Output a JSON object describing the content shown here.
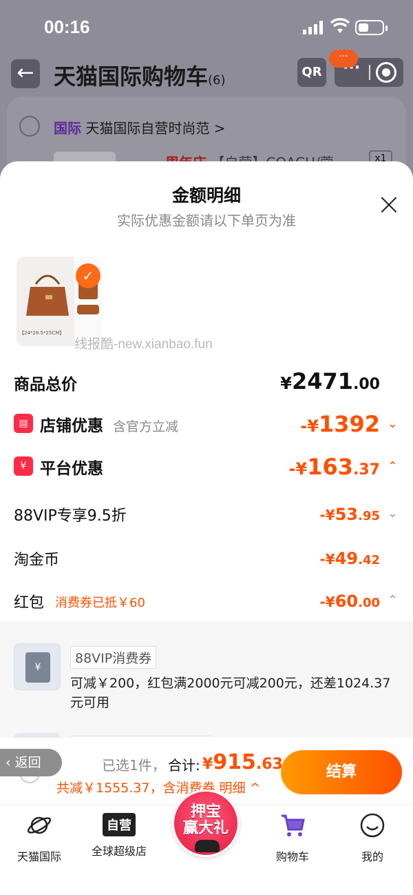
{
  "status_bar": {
    "time": "00:16"
  },
  "header": {
    "title": "天猫国际购物车",
    "count": "(6)",
    "qr_label": "QR",
    "bubble": "···"
  },
  "background_cart": {
    "store_tag": "国际",
    "store_name": "天猫国际自营时尚范 >",
    "product_tag": "周年庆",
    "product_title": "【自营】COACH/蔻",
    "quantity": "x1"
  },
  "sheet": {
    "title": "金额明细",
    "subtitle": "实际优惠金额请以下单页为准",
    "watermark": "线报酷-new.xianbao.fun",
    "thumb_caption": "【24*28.5*25CM】"
  },
  "rows": {
    "total": {
      "label": "商品总价",
      "cur": "¥",
      "int": "2471",
      "dec": ".00"
    },
    "store_discount": {
      "label": "店铺优惠",
      "note": "含官方立减",
      "cur": "-¥",
      "int": "1392",
      "dec": ""
    },
    "platform_discount": {
      "label": "平台优惠",
      "cur": "-¥",
      "int": "163",
      "dec": ".37"
    },
    "vip": {
      "label": "88VIP专享9.5折",
      "cur": "-¥",
      "int": "53",
      "dec": ".95"
    },
    "coins": {
      "label": "淘金币",
      "cur": "-¥",
      "int": "49",
      "dec": ".42"
    },
    "red_packet": {
      "label": "红包",
      "note": "消费券已抵￥60",
      "cur": "-¥",
      "int": "60",
      "dec": ".00"
    }
  },
  "coupon": {
    "tag": "88VIP消费券",
    "description": "可减￥200，红包满2000元可减200元，还差1024.37元可用",
    "icon_symbol": "¥"
  },
  "checkout": {
    "return_label": "返回",
    "selected": "已选1件，",
    "total_label": "合计:",
    "total_cur": "¥",
    "total_int": "915",
    "total_dec": ".63",
    "discount_summary": "共减￥1555.37，含消费券",
    "detail_link": "明细 ^",
    "pay_button": "结算"
  },
  "tabbar": {
    "tabs": [
      {
        "label": "天猫国际",
        "icon": "planet-icon"
      },
      {
        "label": "全球超级店",
        "icon": "ziying-badge",
        "badge": "自营"
      },
      {
        "label": "购物车",
        "icon": "cart-icon"
      },
      {
        "label": "我的",
        "icon": "smile-icon"
      }
    ],
    "promo": {
      "text_line1": "押宝",
      "text_line2": "赢大礼"
    }
  },
  "colors": {
    "accent": "#ff5000",
    "pay_gradient_start": "#ff9a00",
    "pay_gradient_end": "#ff5000",
    "discount_icon": "#ff2a45",
    "intl_tag": "#5d2a9c"
  }
}
